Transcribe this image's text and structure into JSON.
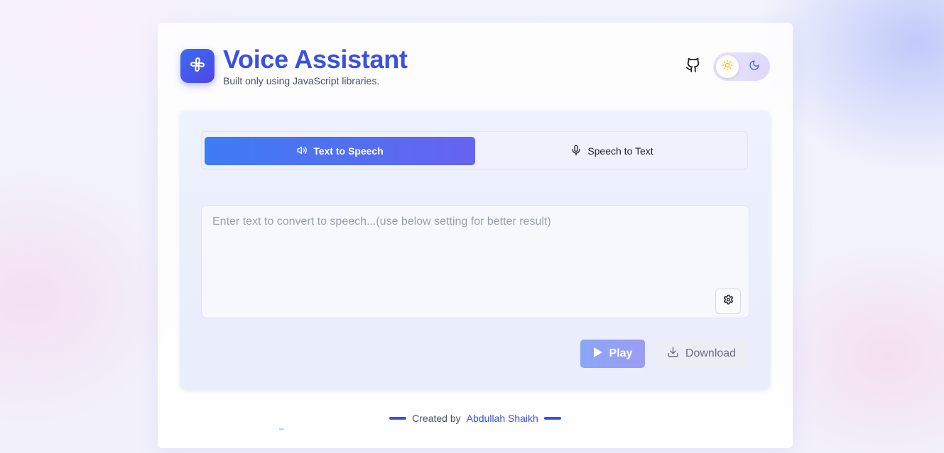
{
  "header": {
    "title": "Voice Assistant",
    "subtitle": "Built only using JavaScript libraries."
  },
  "icons": {
    "logo": "fan-icon",
    "github": "github-icon",
    "light_mode": "sun-icon",
    "dark_mode": "moon-icon",
    "tts": "speaker-icon",
    "stt": "microphone-icon",
    "settings": "gear-icon",
    "play": "play-icon",
    "download": "download-icon"
  },
  "theme": {
    "selected": "light"
  },
  "tabs": [
    {
      "label": "Text to Speech",
      "active": true
    },
    {
      "label": "Speech to Text",
      "active": false
    }
  ],
  "input": {
    "value": "",
    "placeholder": "Enter text to convert to speech...(use below setting for better result)"
  },
  "actions": {
    "play_label": "Play",
    "download_label": "Download"
  },
  "footer": {
    "prefix": "Created by",
    "author": "Abdullah Shaikh"
  },
  "colors": {
    "accent": "#3a50e0",
    "tab_gradient_start": "#3e7cf4",
    "tab_gradient_end": "#6663ef",
    "sun": "#f5b800"
  }
}
